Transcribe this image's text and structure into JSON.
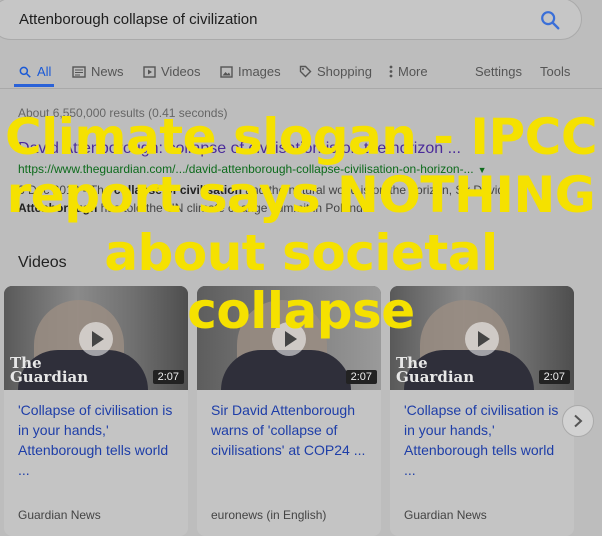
{
  "search": {
    "query": "Attenborough collapse of civilization",
    "icon": "search-icon"
  },
  "tabs": [
    {
      "label": "All",
      "icon": "search-icon"
    },
    {
      "label": "News",
      "icon": "news-icon"
    },
    {
      "label": "Videos",
      "icon": "video-icon"
    },
    {
      "label": "Images",
      "icon": "image-icon"
    },
    {
      "label": "Shopping",
      "icon": "tag-icon"
    },
    {
      "label": "More",
      "icon": "more-icon"
    },
    {
      "label": "Settings"
    },
    {
      "label": "Tools"
    }
  ],
  "result_stats": "About 6,550,000 results (0.41 seconds)",
  "result": {
    "title": "David Attenborough: collapse of civilisation is on the horizon ...",
    "url": "https://www.theguardian.com/.../david-attenborough-collapse-civilisation-on-horizon-...",
    "date": "3 Dec 2018",
    "snippet_mid": " - The ",
    "snippet_bold1": "collapse of civilisation",
    "snippet_rest": " and the natural world is on the horizon, Sir David",
    "snippet_bold2": "Attenborough",
    "snippet_end": " has told the UN climate change summit in Poland."
  },
  "videos_heading": "Videos",
  "videos": [
    {
      "title": "'Collapse of civilisation is in your hands,' Attenborough tells world ...",
      "source": "Guardian News",
      "duration": "2:07",
      "logo": "The Guardian"
    },
    {
      "title": "Sir David Attenborough warns of 'collapse of civilisations' at COP24 ...",
      "source": "euronews (in English)",
      "duration": "2:07",
      "logo": ""
    },
    {
      "title": "'Collapse of civilisation is in your hands,' Attenborough tells world ...",
      "source": "Guardian News",
      "duration": "2:07",
      "logo": "The Guardian"
    }
  ],
  "overlay_text": "Climate slogan - IPCC report says NOTHING about societal collapse",
  "colors": {
    "accent": "#1a59d6",
    "overlay": "#f5e100",
    "link": "#1e3ea8",
    "url": "#0d6b1c"
  }
}
